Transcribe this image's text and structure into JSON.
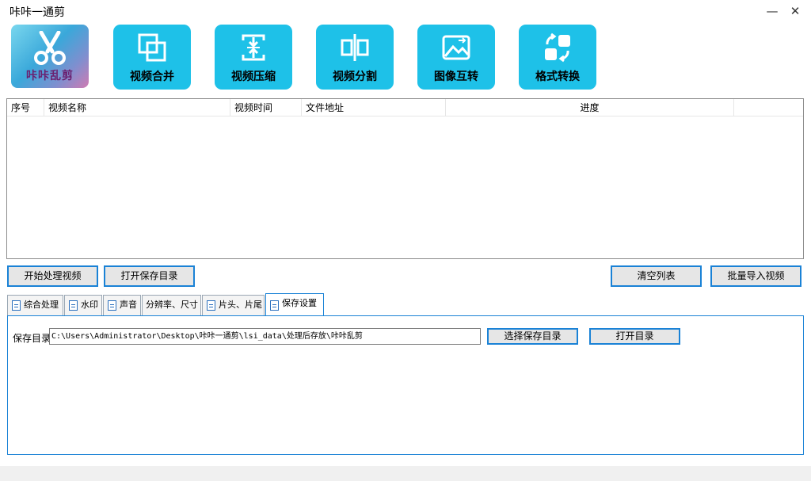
{
  "window": {
    "title": "咔咔一通剪",
    "minimize": "—",
    "close": "✕"
  },
  "logo": {
    "text": "咔咔乱剪",
    "icon": "scissors-icon"
  },
  "toolbar": [
    {
      "label": "视频合并",
      "icon": "merge-icon"
    },
    {
      "label": "视频压缩",
      "icon": "compress-icon"
    },
    {
      "label": "视频分割",
      "icon": "split-icon"
    },
    {
      "label": "图像互转",
      "icon": "image-convert-icon"
    },
    {
      "label": "格式转换",
      "icon": "format-convert-icon"
    }
  ],
  "list": {
    "columns": [
      "序号",
      "视频名称",
      "视频时间",
      "文件地址",
      "进度"
    ],
    "rows": []
  },
  "actions": {
    "start": "开始处理视频",
    "open_save_dir": "打开保存目录",
    "clear_list": "清空列表",
    "batch_import": "批量导入视频"
  },
  "tabs": [
    {
      "label": "综合处理"
    },
    {
      "label": "水印"
    },
    {
      "label": "声音"
    },
    {
      "label": "分辨率、尺寸"
    },
    {
      "label": "片头、片尾"
    },
    {
      "label": "保存设置",
      "active": true
    }
  ],
  "save_settings": {
    "label": "保存目录",
    "path": "C:\\Users\\Administrator\\Desktop\\咔咔一通剪\\lsi_data\\处理后存放\\咔咔乱剪",
    "choose_button": "选择保存目录",
    "open_button": "打开目录"
  },
  "colors": {
    "accent": "#1ec1e8",
    "border_focus": "#1a82d6"
  }
}
